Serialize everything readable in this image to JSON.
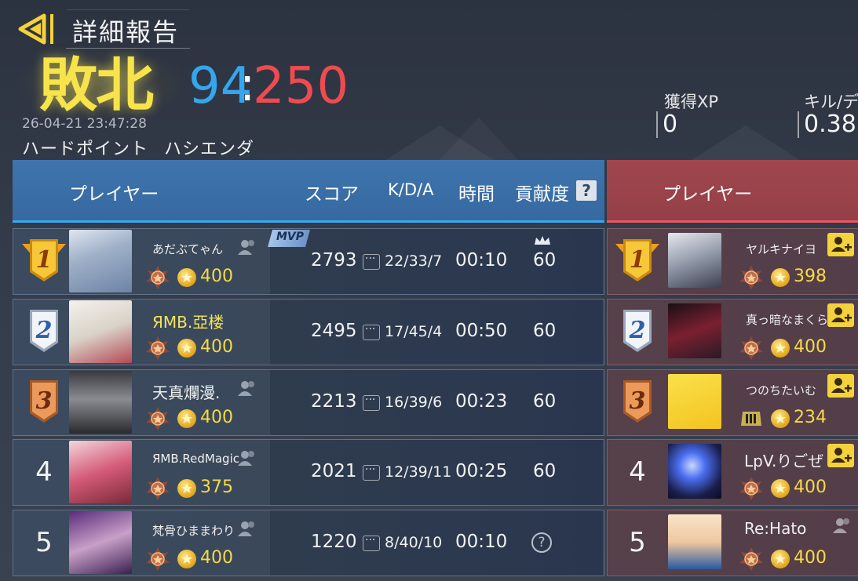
{
  "header": {
    "title": "詳細報告",
    "result": "敗北",
    "score_blue": "94",
    "score_sep": ":",
    "score_red": "250",
    "timestamp": "26-04-21 23:47:28",
    "mode": "ハードポイント",
    "map": "ハシエンダ",
    "stats": [
      {
        "label": "獲得XP",
        "value": "0"
      },
      {
        "label": "キル/デ",
        "value": "0.38"
      }
    ]
  },
  "columns": {
    "player": "プレイヤー",
    "score": "スコア",
    "kda": "K/D/A",
    "time": "時間",
    "contribution": "貢献度",
    "help": "?"
  },
  "mvp_label": "MVP",
  "blue_team": [
    {
      "rank": "1",
      "name": "あだぶてゃん",
      "points": "400",
      "score": "2793",
      "kda": "22/33/7",
      "time": "00:10",
      "contribution": "60"
    },
    {
      "rank": "2",
      "name": "ЯMB.亞楼",
      "points": "400",
      "score": "2495",
      "kda": "17/45/4",
      "time": "00:50",
      "contribution": "60"
    },
    {
      "rank": "3",
      "name": "天真爛漫.",
      "points": "400",
      "score": "2213",
      "kda": "16/39/6",
      "time": "00:23",
      "contribution": "60"
    },
    {
      "rank": "4",
      "name": "ЯMB.RedMagic",
      "points": "375",
      "score": "2021",
      "kda": "12/39/11",
      "time": "00:25",
      "contribution": "60"
    },
    {
      "rank": "5",
      "name": "梵骨ひままわり",
      "points": "400",
      "score": "1220",
      "kda": "8/40/10",
      "time": "00:10",
      "contribution": "?"
    }
  ],
  "red_team": [
    {
      "rank": "1",
      "name": "ヤルキナイヨ",
      "points": "398"
    },
    {
      "rank": "2",
      "name": "真っ暗なまくら",
      "points": "400"
    },
    {
      "rank": "3",
      "name": "つのちたいむ",
      "points": "234"
    },
    {
      "rank": "4",
      "name": "LpV.りごぜ",
      "points": "400"
    },
    {
      "rank": "5",
      "name": "Re:Hato",
      "points": "400"
    }
  ],
  "colors": {
    "blue_accent": "#39a8ef",
    "red_accent": "#ea5860",
    "defeat_gold": "#f7e34b",
    "points_gold": "#f5d94a"
  },
  "icons": {
    "back": "back-arrow-icon",
    "help": "question-icon",
    "coin": "star-coin-icon",
    "emblem": "rank-emblem-icon",
    "add_friend": "add-friend-icon",
    "crown": "crown-icon"
  }
}
